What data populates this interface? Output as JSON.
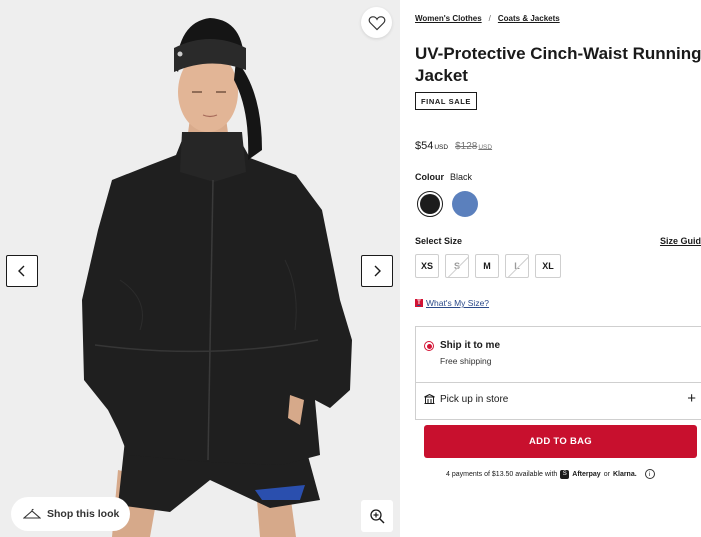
{
  "gallery": {
    "wishlist_icon": "heart-icon",
    "prev_icon": "chevron-left-icon",
    "next_icon": "chevron-right-icon",
    "zoom_icon": "zoom-in-icon",
    "shop_look_label": "Shop this look",
    "shop_look_icon": "hanger-icon"
  },
  "breadcrumbs": [
    "Women's Clothes",
    "Coats & Jackets"
  ],
  "breadcrumb_separator": "/",
  "product": {
    "title_line1": "UV-Protective Cinch-Waist Running",
    "title_line2": "Jacket",
    "badge": "FINAL SALE",
    "price": "$54",
    "price_currency": "USD",
    "original_price": "$128",
    "original_currency": "USD"
  },
  "colour": {
    "label": "Colour",
    "selected": "Black",
    "swatches": [
      {
        "name": "Black",
        "hex": "#1c1c1c"
      },
      {
        "name": "Blue",
        "hex": "#5b80bd"
      }
    ]
  },
  "size": {
    "label": "Select Size",
    "guide_label": "Size Guid",
    "options": [
      {
        "label": "XS",
        "available": true
      },
      {
        "label": "S",
        "available": false
      },
      {
        "label": "M",
        "available": true
      },
      {
        "label": "L",
        "available": false
      },
      {
        "label": "XL",
        "available": true
      }
    ],
    "whats_my_size": "What's My Size?"
  },
  "fulfillment": {
    "ship_title": "Ship it to me",
    "ship_sub": "Free shipping",
    "pickup_label": "Pick up in store"
  },
  "cta": {
    "add_to_bag": "ADD TO BAG"
  },
  "payment": {
    "text": "4 payments of $13.50 available with",
    "afterpay_icon": "S",
    "afterpay": "Afterpay",
    "or": "or",
    "klarna": "Klarna."
  },
  "colors": {
    "accent_red": "#c8102e",
    "link_blue": "#2b4a8a"
  }
}
